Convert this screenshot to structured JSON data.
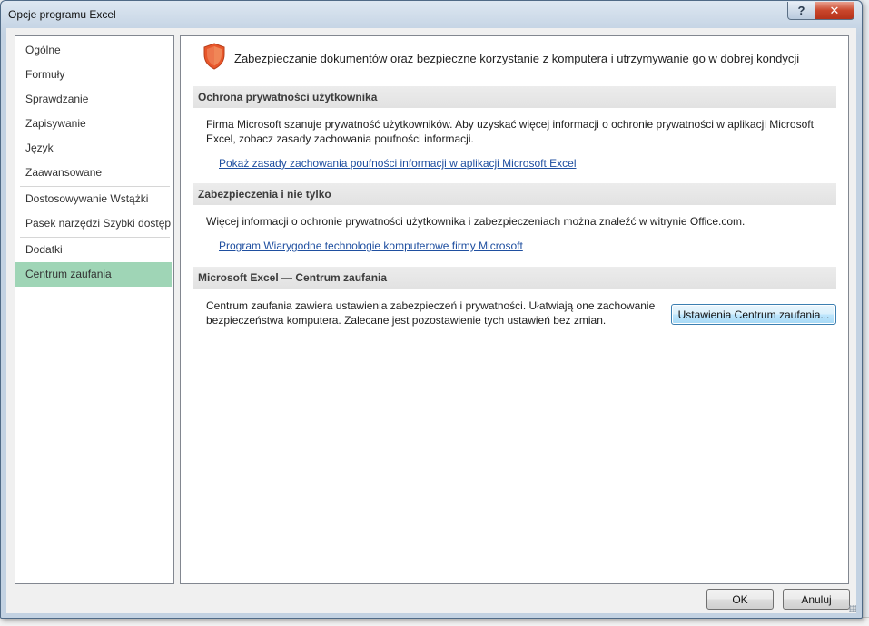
{
  "window": {
    "title": "Opcje programu Excel",
    "help_label": "?",
    "close_label": "✕"
  },
  "sidebar": {
    "items": [
      {
        "label": "Ogólne"
      },
      {
        "label": "Formuły"
      },
      {
        "label": "Sprawdzanie"
      },
      {
        "label": "Zapisywanie"
      },
      {
        "label": "Język"
      },
      {
        "label": "Zaawansowane"
      },
      {
        "label": "Dostosowywanie Wstążki"
      },
      {
        "label": "Pasek narzędzi Szybki dostęp"
      },
      {
        "label": "Dodatki"
      },
      {
        "label": "Centrum zaufania"
      }
    ],
    "active": "Centrum zaufania"
  },
  "main": {
    "heading": "Zabezpieczanie dokumentów oraz bezpieczne korzystanie z komputera i utrzymywanie go w dobrej kondycji",
    "icon": "shield-icon",
    "sections": [
      {
        "title": "Ochrona prywatności użytkownika",
        "lines": [
          "Firma Microsoft szanuje prywatność użytkowników. Aby uzyskać więcej informacji o ochronie prywatności w aplikacji Microsoft",
          "Excel, zobacz zasady zachowania poufności informacji."
        ],
        "link": "Pokaż zasady zachowania poufności informacji w aplikacji Microsoft Excel"
      },
      {
        "title": "Zabezpieczenia i nie tylko",
        "lines": [
          "Więcej informacji o ochronie prywatności użytkownika i zabezpieczeniach można znaleźć w witrynie Office.com."
        ],
        "link": "Program Wiarygodne technologie komputerowe firmy Microsoft"
      },
      {
        "title": "Microsoft Excel — Centrum zaufania",
        "lines": [
          "Centrum zaufania zawiera ustawienia zabezpieczeń i prywatności. Ułatwiają one zachowanie",
          "bezpieczeństwa komputera. Zalecane jest pozostawienie tych ustawień bez zmian."
        ],
        "button": "Ustawienia Centrum zaufania..."
      }
    ]
  },
  "footer": {
    "ok_label": "OK",
    "cancel_label": "Anuluj"
  },
  "colors": {
    "active_nav": "#9fd5b6",
    "link": "#1f4fa0",
    "shield": "#e8562a"
  }
}
